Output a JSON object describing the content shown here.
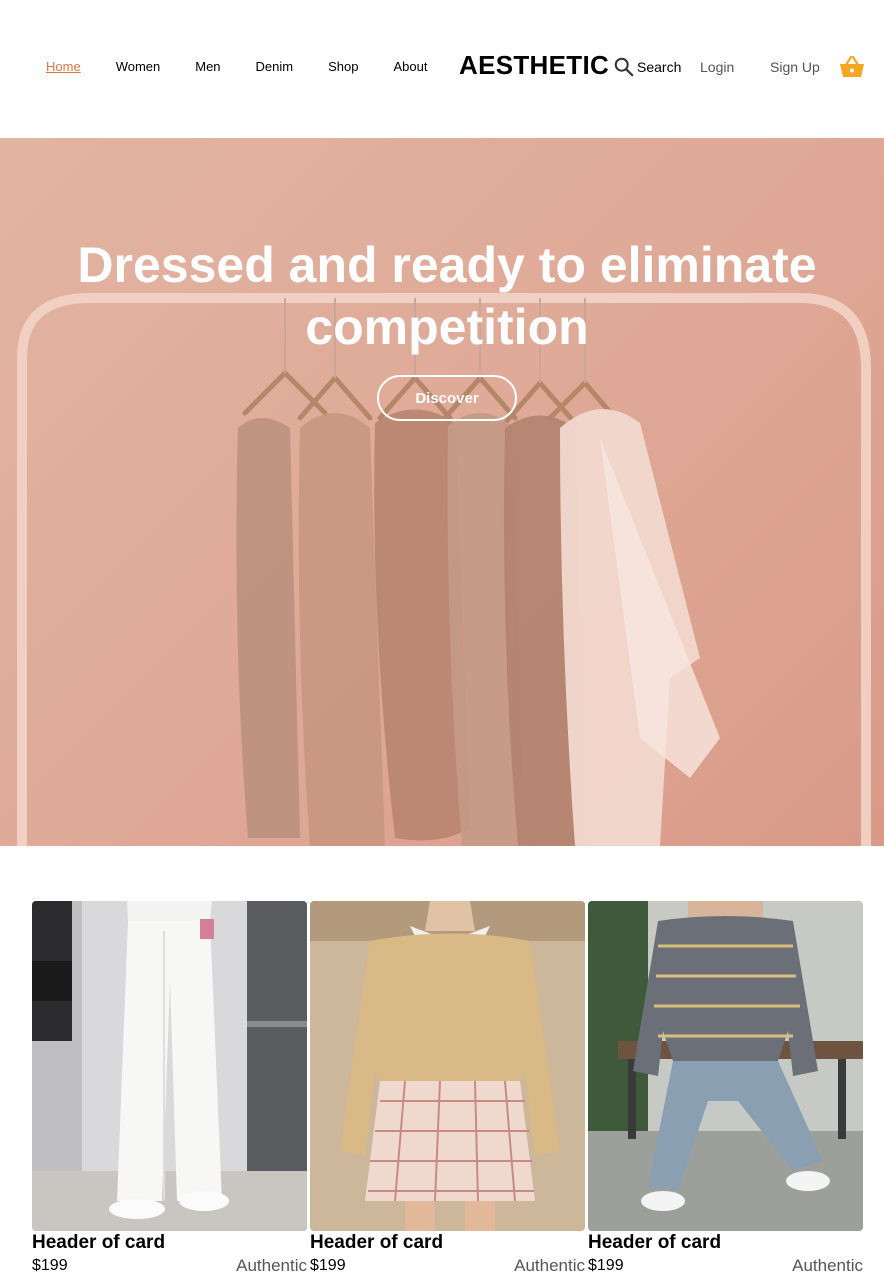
{
  "nav": {
    "links": [
      {
        "label": "Home",
        "active": true
      },
      {
        "label": "Women",
        "active": false
      },
      {
        "label": "Men",
        "active": false
      },
      {
        "label": "Denim",
        "active": false
      },
      {
        "label": "Shop",
        "active": false
      },
      {
        "label": "About",
        "active": false
      }
    ],
    "brand": "AESTHETIC",
    "search_label": "Search",
    "search_icon": "search-icon",
    "login_label": "Login",
    "signup_label": "Sign Up",
    "cart_icon": "basket-icon",
    "accent_color": "#d9763f",
    "cart_color": "#f5a623"
  },
  "hero": {
    "title": "Dressed and ready to eliminate competition",
    "button_label": "Discover"
  },
  "cards": [
    {
      "title": "Header of card",
      "price": "$199",
      "tag": "Authentic"
    },
    {
      "title": "Header of card",
      "price": "$199",
      "tag": "Authentic"
    },
    {
      "title": "Header of card",
      "price": "$199",
      "tag": "Authentic"
    }
  ]
}
